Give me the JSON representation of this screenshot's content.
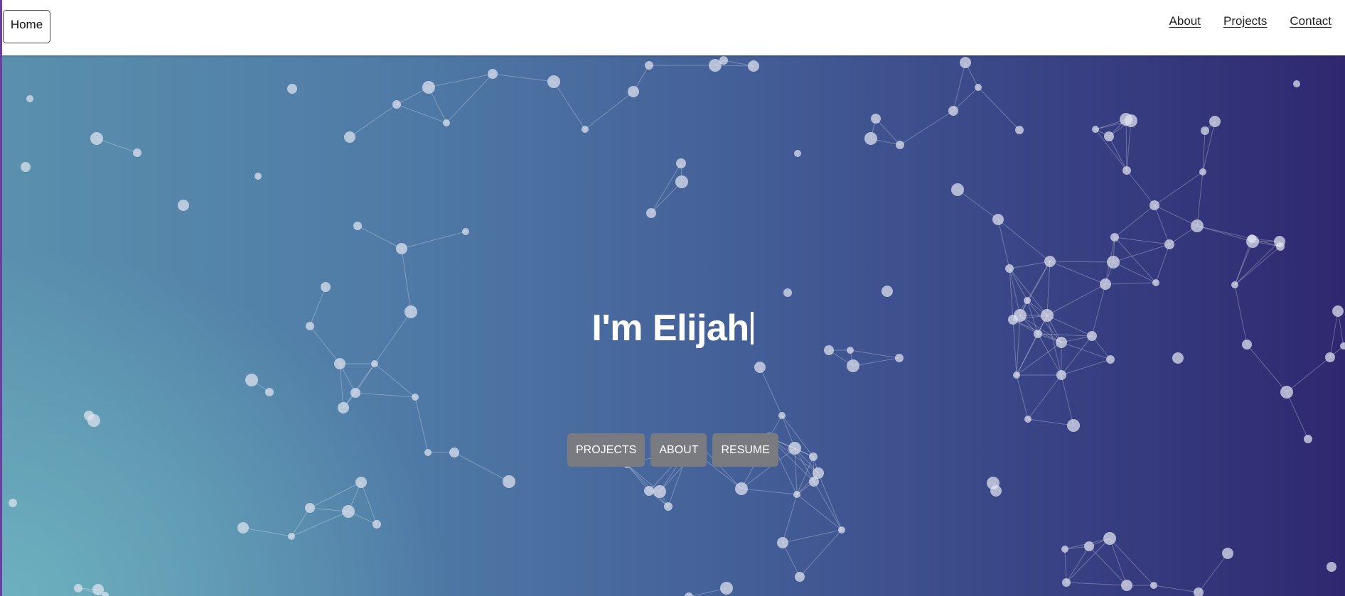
{
  "nav": {
    "home_label": "Home",
    "links": [
      {
        "label": "About"
      },
      {
        "label": "Projects"
      },
      {
        "label": "Contact"
      }
    ]
  },
  "hero": {
    "title": "I'm Elijah",
    "buttons": [
      {
        "label": "PROJECTS"
      },
      {
        "label": "ABOUT"
      },
      {
        "label": "RESUME"
      }
    ]
  },
  "colors": {
    "gradient_left": "#6eb2c0",
    "gradient_mid": "#4f7aa6",
    "gradient_right": "#2f2870",
    "button_bg": "#7a7b80",
    "left_edge": "#6b3fa0"
  }
}
